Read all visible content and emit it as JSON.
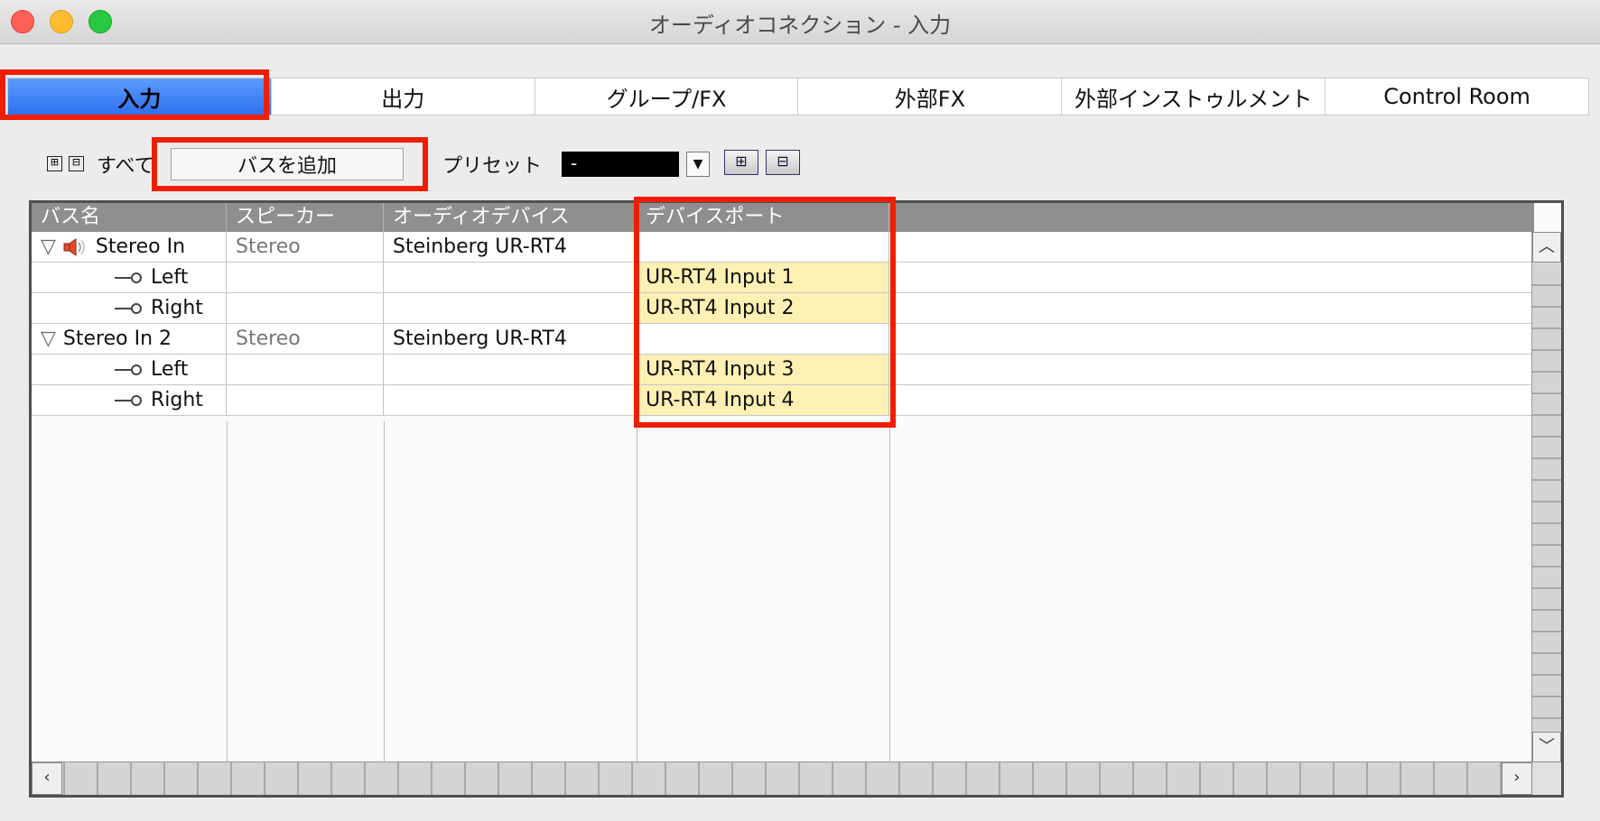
{
  "window": {
    "title": "オーディオコネクション - 入力"
  },
  "tabs": [
    {
      "label": "入力",
      "active": true
    },
    {
      "label": "出力"
    },
    {
      "label": "グループ/FX"
    },
    {
      "label": "外部FX"
    },
    {
      "label": "外部インストゥルメント"
    },
    {
      "label": "Control Room"
    }
  ],
  "toolbar": {
    "all_label": "すべて",
    "expand_icon": "⊞",
    "collapse_icon": "⊟",
    "add_bus_label": "バスを追加",
    "preset_label": "プリセット",
    "preset_value": "-",
    "preset_store_icon": "plus-preset-icon",
    "preset_remove_icon": "minus-preset-icon"
  },
  "table": {
    "columns": [
      "バス名",
      "スピーカー",
      "オーディオデバイス",
      "デバイスポート",
      ""
    ],
    "rows": [
      {
        "type": "bus",
        "name": "Stereo In",
        "speaker": "Stereo",
        "device": "Steinberg UR-RT4",
        "port": "",
        "icon": "speaker-icon"
      },
      {
        "type": "channel",
        "name": "Left",
        "speaker": "",
        "device": "",
        "port": "UR-RT4 Input 1"
      },
      {
        "type": "channel",
        "name": "Right",
        "speaker": "",
        "device": "",
        "port": "UR-RT4 Input 2"
      },
      {
        "type": "bus",
        "name": "Stereo In 2",
        "speaker": "Stereo",
        "device": "Steinberg UR-RT4",
        "port": ""
      },
      {
        "type": "channel",
        "name": "Left",
        "speaker": "",
        "device": "",
        "port": "UR-RT4 Input 3"
      },
      {
        "type": "channel",
        "name": "Right",
        "speaker": "",
        "device": "",
        "port": "UR-RT4 Input 4"
      }
    ]
  },
  "colors": {
    "highlight_border": "#f01e00",
    "active_tab": "#3a7cf5",
    "port_cell": "#fdf0b3",
    "header_bg": "#8f8f8f"
  }
}
